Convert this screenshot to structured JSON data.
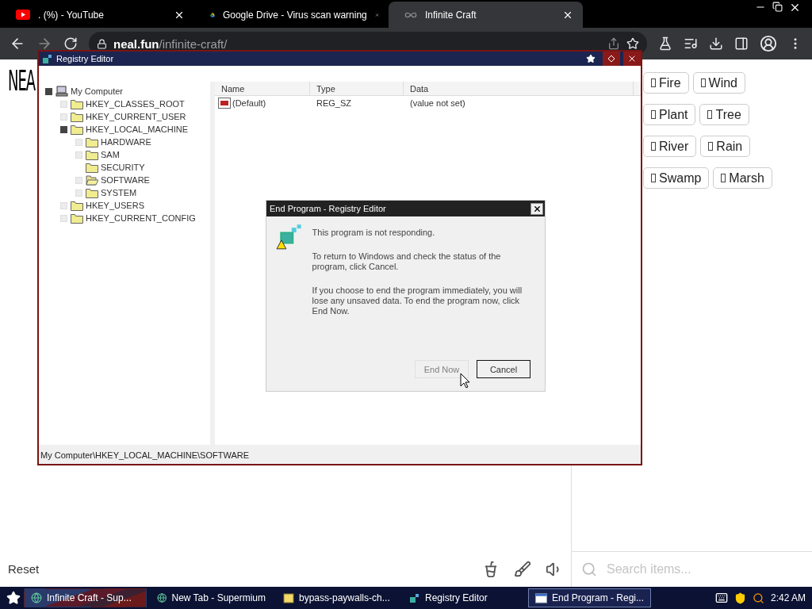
{
  "browser": {
    "tabs": [
      {
        "title": ". (%) - YouTube",
        "selected": false
      },
      {
        "title": "Google Drive - Virus scan warning",
        "selected": false
      },
      {
        "title": "Infinite Craft",
        "selected": true
      }
    ],
    "address": {
      "host": "neal.fun",
      "path": "/infinite-craft/"
    }
  },
  "page": {
    "logo": "NEA",
    "items": [
      {
        "label": "Fire"
      },
      {
        "label": "Wind"
      },
      {
        "label": "Plant"
      },
      {
        "label": "Tree"
      },
      {
        "label": "River"
      },
      {
        "label": "Rain"
      },
      {
        "label": "Swamp"
      },
      {
        "label": "Marsh"
      }
    ],
    "reset": "Reset",
    "search": {
      "placeholder": "Search items..."
    }
  },
  "registry_editor": {
    "title": "Registry Editor",
    "tree": [
      {
        "label": "My Computer",
        "kind": "computer",
        "expandable": true,
        "expanded": true,
        "selected": false,
        "children": [
          {
            "label": "HKEY_CLASSES_ROOT",
            "kind": "folder",
            "expandable": true,
            "expanded": false,
            "selected": false
          },
          {
            "label": "HKEY_CURRENT_USER",
            "kind": "folder",
            "expandable": true,
            "expanded": false,
            "selected": false
          },
          {
            "label": "HKEY_LOCAL_MACHINE",
            "kind": "folder",
            "expandable": true,
            "expanded": true,
            "selected": false,
            "children": [
              {
                "label": "HARDWARE",
                "kind": "folder",
                "expandable": true,
                "expanded": false,
                "selected": false
              },
              {
                "label": "SAM",
                "kind": "folder",
                "expandable": true,
                "expanded": false,
                "selected": false
              },
              {
                "label": "SECURITY",
                "kind": "folder",
                "expandable": false,
                "expanded": false,
                "selected": false
              },
              {
                "label": "SOFTWARE",
                "kind": "folder",
                "expandable": true,
                "expanded": false,
                "selected": true
              },
              {
                "label": "SYSTEM",
                "kind": "folder",
                "expandable": true,
                "expanded": false,
                "selected": false
              }
            ]
          },
          {
            "label": "HKEY_USERS",
            "kind": "folder",
            "expandable": true,
            "expanded": false,
            "selected": false
          },
          {
            "label": "HKEY_CURRENT_CONFIG",
            "kind": "folder",
            "expandable": true,
            "expanded": false,
            "selected": false
          }
        ]
      }
    ],
    "columns": [
      "Name",
      "Type",
      "Data"
    ],
    "rows": [
      {
        "name": "(Default)",
        "type": "REG_SZ",
        "data": "(value not set)"
      }
    ],
    "status_bar": "My Computer\\HKEY_LOCAL_MACHINE\\SOFTWARE"
  },
  "dialog": {
    "title": "End Program - Registry Editor",
    "paragraphs": [
      "This program is not responding.",
      "To return to Windows and check the status of the program, click Cancel.",
      "If you choose to end the program immediately, you will lose any unsaved data. To end the program now, click End Now."
    ],
    "buttons": [
      {
        "label": "End Now",
        "disabled": true,
        "default": false
      },
      {
        "label": "Cancel",
        "disabled": false,
        "default": true
      }
    ]
  },
  "taskbar": {
    "items": [
      {
        "label": "Infinite Craft - Sup...",
        "selected": false
      },
      {
        "label": "New Tab - Supermium",
        "selected": false
      },
      {
        "label": "bypass-paywalls-ch...",
        "selected": false
      },
      {
        "label": "Registry Editor",
        "selected": false
      },
      {
        "label": "End Program - Regi...",
        "selected": true
      }
    ],
    "clock": "2:42 AM"
  }
}
